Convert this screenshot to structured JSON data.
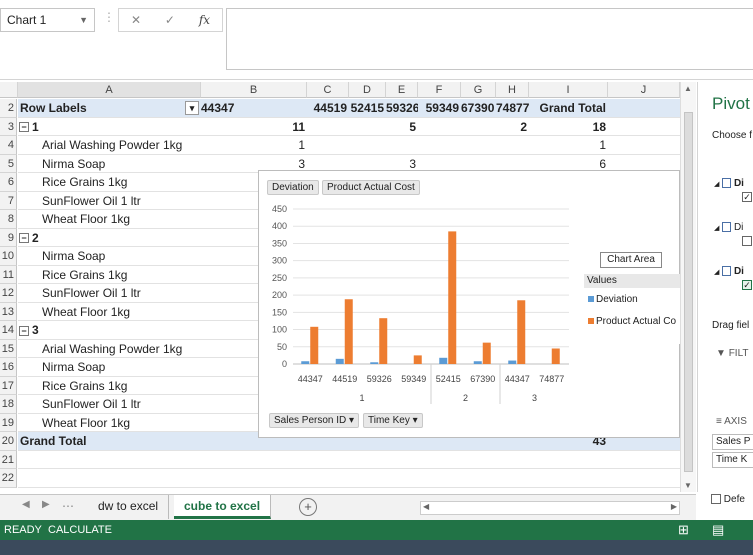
{
  "formula_bar": {
    "name_box": "Chart 1",
    "cancel_glyph": "✕",
    "enter_glyph": "✓",
    "fx_label": "fx"
  },
  "columns": [
    "A",
    "B",
    "C",
    "D",
    "E",
    "F",
    "G",
    "H",
    "I",
    "J"
  ],
  "rows": [
    {
      "n": "2",
      "a": "Row Labels",
      "b": "44347",
      "c": "44519",
      "d": "52415",
      "e": "59326",
      "f": "59349",
      "g": "67390",
      "h": "74877",
      "i": "Grand Total",
      "kind": "header"
    },
    {
      "n": "3",
      "a": "1",
      "b": "11",
      "c": "",
      "d": "",
      "e": "5",
      "f": "",
      "g": "",
      "h": "2",
      "i": "18",
      "kind": "group"
    },
    {
      "n": "4",
      "a": "Arial Washing Powder 1kg",
      "b": "1",
      "c": "",
      "d": "",
      "e": "",
      "f": "",
      "g": "",
      "h": "",
      "i": "1",
      "kind": "item"
    },
    {
      "n": "5",
      "a": "Nirma Soap",
      "b": "3",
      "c": "",
      "d": "",
      "e": "3",
      "f": "",
      "g": "",
      "h": "",
      "i": "6",
      "kind": "item"
    },
    {
      "n": "6",
      "a": "Rice Grains 1kg",
      "b": "",
      "c": "",
      "d": "",
      "e": "",
      "f": "",
      "g": "",
      "h": "",
      "i": "",
      "kind": "item"
    },
    {
      "n": "7",
      "a": "SunFlower Oil 1 ltr",
      "b": "",
      "c": "",
      "d": "",
      "e": "",
      "f": "",
      "g": "",
      "h": "",
      "i": "",
      "kind": "item"
    },
    {
      "n": "8",
      "a": "Wheat Floor 1kg",
      "b": "",
      "c": "",
      "d": "",
      "e": "",
      "f": "",
      "g": "",
      "h": "",
      "i": "",
      "kind": "item"
    },
    {
      "n": "9",
      "a": "2",
      "b": "",
      "c": "",
      "d": "",
      "e": "",
      "f": "",
      "g": "",
      "h": "",
      "i": "",
      "kind": "group"
    },
    {
      "n": "10",
      "a": "Nirma Soap",
      "b": "",
      "c": "",
      "d": "",
      "e": "",
      "f": "",
      "g": "",
      "h": "",
      "i": "",
      "kind": "item"
    },
    {
      "n": "11",
      "a": "Rice Grains 1kg",
      "b": "",
      "c": "",
      "d": "",
      "e": "",
      "f": "",
      "g": "",
      "h": "",
      "i": "",
      "kind": "item"
    },
    {
      "n": "12",
      "a": "SunFlower Oil 1 ltr",
      "b": "",
      "c": "",
      "d": "",
      "e": "",
      "f": "",
      "g": "",
      "h": "",
      "i": "",
      "kind": "item"
    },
    {
      "n": "13",
      "a": "Wheat Floor 1kg",
      "b": "",
      "c": "",
      "d": "",
      "e": "",
      "f": "",
      "g": "",
      "h": "",
      "i": "",
      "kind": "item"
    },
    {
      "n": "14",
      "a": "3",
      "b": "",
      "c": "",
      "d": "",
      "e": "",
      "f": "",
      "g": "",
      "h": "",
      "i": "",
      "kind": "group"
    },
    {
      "n": "15",
      "a": "Arial Washing Powder 1kg",
      "b": "",
      "c": "",
      "d": "",
      "e": "",
      "f": "",
      "g": "",
      "h": "",
      "i": "",
      "kind": "item"
    },
    {
      "n": "16",
      "a": "Nirma Soap",
      "b": "",
      "c": "",
      "d": "",
      "e": "",
      "f": "",
      "g": "",
      "h": "",
      "i": "",
      "kind": "item"
    },
    {
      "n": "17",
      "a": "Rice Grains 1kg",
      "b": "",
      "c": "",
      "d": "",
      "e": "",
      "f": "",
      "g": "",
      "h": "",
      "i": "",
      "kind": "item"
    },
    {
      "n": "18",
      "a": "SunFlower Oil 1 ltr",
      "b": "",
      "c": "",
      "d": "",
      "e": "",
      "f": "",
      "g": "",
      "h": "",
      "i": "",
      "kind": "item"
    },
    {
      "n": "19",
      "a": "Wheat Floor 1kg",
      "b": "",
      "c": "",
      "d": "",
      "e": "",
      "f": "",
      "g": "",
      "h": "",
      "i": "",
      "kind": "item"
    },
    {
      "n": "20",
      "a": "Grand Total",
      "b": "",
      "c": "",
      "d": "",
      "e": "",
      "f": "",
      "g": "",
      "h": "",
      "i": "43",
      "kind": "total"
    },
    {
      "n": "21",
      "a": "",
      "b": "",
      "c": "",
      "d": "",
      "e": "",
      "f": "",
      "g": "",
      "h": "",
      "i": "",
      "kind": "empty"
    },
    {
      "n": "22",
      "a": "",
      "b": "",
      "c": "",
      "d": "",
      "e": "",
      "f": "",
      "g": "",
      "h": "",
      "i": "",
      "kind": "empty"
    }
  ],
  "chart": {
    "value_buttons": [
      "Deviation",
      "Product Actual Cost"
    ],
    "axis_buttons": [
      "Sales Person ID",
      "Time Key"
    ],
    "tooltip": "Chart Area",
    "legend_title": "Values",
    "colors": {
      "deviation": "#5b9bd5",
      "cost": "#ed7d31"
    }
  },
  "chart_data": {
    "type": "bar",
    "categories": [
      "44347",
      "44519",
      "59326",
      "59349",
      "52415",
      "67390",
      "44347",
      "74877"
    ],
    "groups": [
      {
        "label": "1",
        "span": 4
      },
      {
        "label": "2",
        "span": 2
      },
      {
        "label": "3",
        "span": 2
      }
    ],
    "series": [
      {
        "name": "Deviation",
        "values": [
          8,
          15,
          5,
          0,
          18,
          8,
          10,
          0
        ]
      },
      {
        "name": "Product Actual Cost",
        "values": [
          108,
          188,
          133,
          25,
          385,
          62,
          185,
          45
        ]
      }
    ],
    "yticks": [
      0,
      50,
      100,
      150,
      200,
      250,
      300,
      350,
      400,
      450
    ],
    "ylim": [
      0,
      450
    ],
    "legend": [
      "Deviation",
      "Product Actual Co"
    ]
  },
  "pivot_pane": {
    "title": "Pivot",
    "choose": "Choose f",
    "field1": "Di",
    "field2": "Di",
    "field3": "Di",
    "drag": "Drag fiel",
    "filters": "FILT",
    "axis": "AXIS",
    "axis_item1": "Sales P",
    "axis_item2": "Time K",
    "defer": "Defe"
  },
  "tabs": {
    "tab1": "dw to excel",
    "tab2": "cube to excel",
    "add": "+"
  },
  "status": {
    "ready": "READY",
    "calc": "CALCULATE"
  }
}
